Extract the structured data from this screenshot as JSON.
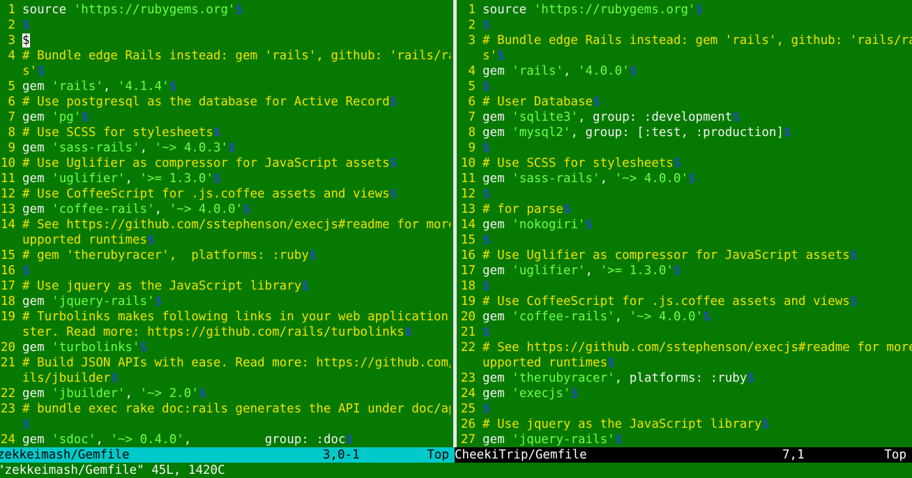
{
  "colors": {
    "background": "#067a00",
    "line_number": "#f2e200",
    "comment": "#f2e200",
    "string": "#6cff4a",
    "eol_marker": "#2a3dff",
    "active_status": "#00c9c9",
    "inactive_status": "#000000"
  },
  "left": {
    "lines": [
      {
        "n": "1",
        "segs": [
          [
            "kw",
            "source "
          ],
          [
            "str",
            "'https://rubygems.org'"
          ],
          [
            "eol",
            "$"
          ]
        ]
      },
      {
        "n": "2",
        "segs": [
          [
            "eol",
            "$"
          ]
        ]
      },
      {
        "n": "3",
        "segs": [
          [
            "cursor",
            "$"
          ]
        ]
      },
      {
        "n": "4",
        "segs": [
          [
            "cmt",
            "# Bundle edge Rails instead: gem 'rails', github: 'rails/rail"
          ]
        ]
      },
      {
        "n": "",
        "segs": [
          [
            "cmt",
            "s'"
          ],
          [
            "eol",
            "$"
          ]
        ]
      },
      {
        "n": "5",
        "segs": [
          [
            "kw",
            "gem "
          ],
          [
            "str",
            "'rails'"
          ],
          [
            "kw",
            ", "
          ],
          [
            "str",
            "'4.1.4'"
          ],
          [
            "eol",
            "$"
          ]
        ]
      },
      {
        "n": "6",
        "segs": [
          [
            "cmt",
            "# Use postgresql as the database for Active Record"
          ],
          [
            "eol",
            "$"
          ]
        ]
      },
      {
        "n": "7",
        "segs": [
          [
            "kw",
            "gem "
          ],
          [
            "str",
            "'pg'"
          ],
          [
            "eol",
            "$"
          ]
        ]
      },
      {
        "n": "8",
        "segs": [
          [
            "cmt",
            "# Use SCSS for stylesheets"
          ],
          [
            "eol",
            "$"
          ]
        ]
      },
      {
        "n": "9",
        "segs": [
          [
            "kw",
            "gem "
          ],
          [
            "str",
            "'sass-rails'"
          ],
          [
            "kw",
            ", "
          ],
          [
            "str",
            "'~> 4.0.3'"
          ],
          [
            "eol",
            "$"
          ]
        ]
      },
      {
        "n": "10",
        "segs": [
          [
            "cmt",
            "# Use Uglifier as compressor for JavaScript assets"
          ],
          [
            "eol",
            "$"
          ]
        ]
      },
      {
        "n": "11",
        "segs": [
          [
            "kw",
            "gem "
          ],
          [
            "str",
            "'uglifier'"
          ],
          [
            "kw",
            ", "
          ],
          [
            "str",
            "'>= 1.3.0'"
          ],
          [
            "eol",
            "$"
          ]
        ]
      },
      {
        "n": "12",
        "segs": [
          [
            "cmt",
            "# Use CoffeeScript for .js.coffee assets and views"
          ],
          [
            "eol",
            "$"
          ]
        ]
      },
      {
        "n": "13",
        "segs": [
          [
            "kw",
            "gem "
          ],
          [
            "str",
            "'coffee-rails'"
          ],
          [
            "kw",
            ", "
          ],
          [
            "str",
            "'~> 4.0.0'"
          ],
          [
            "eol",
            "$"
          ]
        ]
      },
      {
        "n": "14",
        "segs": [
          [
            "cmt",
            "# See https://github.com/sstephenson/execjs#readme for more s"
          ]
        ]
      },
      {
        "n": "",
        "segs": [
          [
            "cmt",
            "upported runtimes"
          ],
          [
            "eol",
            "$"
          ]
        ]
      },
      {
        "n": "15",
        "segs": [
          [
            "cmt",
            "# gem 'therubyracer',  platforms: :ruby"
          ],
          [
            "eol",
            "$"
          ]
        ]
      },
      {
        "n": "16",
        "segs": [
          [
            "eol",
            "$"
          ]
        ]
      },
      {
        "n": "17",
        "segs": [
          [
            "cmt",
            "# Use jquery as the JavaScript library"
          ],
          [
            "eol",
            "$"
          ]
        ]
      },
      {
        "n": "18",
        "segs": [
          [
            "kw",
            "gem "
          ],
          [
            "str",
            "'jquery-rails'"
          ],
          [
            "eol",
            "$"
          ]
        ]
      },
      {
        "n": "19",
        "segs": [
          [
            "cmt",
            "# Turbolinks makes following links in your web application fa"
          ]
        ]
      },
      {
        "n": "",
        "segs": [
          [
            "cmt",
            "ster. Read more: https://github.com/rails/turbolinks"
          ],
          [
            "eol",
            "$"
          ]
        ]
      },
      {
        "n": "20",
        "segs": [
          [
            "kw",
            "gem "
          ],
          [
            "str",
            "'turbolinks'"
          ],
          [
            "eol",
            "$"
          ]
        ]
      },
      {
        "n": "21",
        "segs": [
          [
            "cmt",
            "# Build JSON APIs with ease. Read more: https://github.com/ra"
          ]
        ]
      },
      {
        "n": "",
        "segs": [
          [
            "cmt",
            "ils/jbuilder"
          ],
          [
            "eol",
            "$"
          ]
        ]
      },
      {
        "n": "22",
        "segs": [
          [
            "kw",
            "gem "
          ],
          [
            "str",
            "'jbuilder'"
          ],
          [
            "kw",
            ", "
          ],
          [
            "str",
            "'~> 2.0'"
          ],
          [
            "eol",
            "$"
          ]
        ]
      },
      {
        "n": "23",
        "segs": [
          [
            "cmt",
            "# bundle exec rake doc:rails generates the API under doc/api."
          ]
        ]
      },
      {
        "n": "",
        "segs": [
          [
            "eol",
            "$"
          ]
        ]
      },
      {
        "n": "24",
        "segs": [
          [
            "kw",
            "gem "
          ],
          [
            "str",
            "'sdoc'"
          ],
          [
            "kw",
            ", "
          ],
          [
            "str",
            "'~> 0.4.0'"
          ],
          [
            "kw",
            ",          group: :doc"
          ],
          [
            "eol",
            "$"
          ]
        ]
      }
    ],
    "status": {
      "file": "zekkeimash/Gemfile",
      "position": "3,0-1",
      "percent": "Top"
    }
  },
  "right": {
    "lines": [
      {
        "n": "1",
        "segs": [
          [
            "kw",
            "source "
          ],
          [
            "str",
            "'https://rubygems.org'"
          ],
          [
            "eol",
            "$"
          ]
        ]
      },
      {
        "n": "2",
        "segs": [
          [
            "eol",
            "$"
          ]
        ]
      },
      {
        "n": "3",
        "segs": [
          [
            "cmt",
            "# Bundle edge Rails instead: gem 'rails', github: 'rails/rail"
          ]
        ]
      },
      {
        "n": "",
        "segs": [
          [
            "cmt",
            "s'"
          ],
          [
            "eol",
            "$"
          ]
        ]
      },
      {
        "n": "4",
        "segs": [
          [
            "kw",
            "gem "
          ],
          [
            "str",
            "'rails'"
          ],
          [
            "kw",
            ", "
          ],
          [
            "str",
            "'4.0.0'"
          ],
          [
            "eol",
            "$"
          ]
        ]
      },
      {
        "n": "5",
        "segs": [
          [
            "eol",
            "$"
          ]
        ]
      },
      {
        "n": "6",
        "segs": [
          [
            "cmt",
            "# User Database"
          ],
          [
            "eol",
            "$"
          ]
        ]
      },
      {
        "n": "7",
        "segs": [
          [
            "kw",
            "gem "
          ],
          [
            "str",
            "'sqlite3'"
          ],
          [
            "kw",
            ", group: :development"
          ],
          [
            "eol",
            "$"
          ]
        ]
      },
      {
        "n": "8",
        "segs": [
          [
            "kw",
            "gem "
          ],
          [
            "str",
            "'mysql2'"
          ],
          [
            "kw",
            ", group: [:test, :production]"
          ],
          [
            "eol",
            "$"
          ]
        ]
      },
      {
        "n": "9",
        "segs": [
          [
            "eol",
            "$"
          ]
        ]
      },
      {
        "n": "10",
        "segs": [
          [
            "cmt",
            "# Use SCSS for stylesheets"
          ],
          [
            "eol",
            "$"
          ]
        ]
      },
      {
        "n": "11",
        "segs": [
          [
            "kw",
            "gem "
          ],
          [
            "str",
            "'sass-rails'"
          ],
          [
            "kw",
            ", "
          ],
          [
            "str",
            "'~> 4.0.0'"
          ],
          [
            "eol",
            "$"
          ]
        ]
      },
      {
        "n": "12",
        "segs": [
          [
            "eol",
            "$"
          ]
        ]
      },
      {
        "n": "13",
        "segs": [
          [
            "cmt",
            "# for parse"
          ],
          [
            "eol",
            "$"
          ]
        ]
      },
      {
        "n": "14",
        "segs": [
          [
            "kw",
            "gem "
          ],
          [
            "str",
            "'nokogiri'"
          ],
          [
            "eol",
            "$"
          ]
        ]
      },
      {
        "n": "15",
        "segs": [
          [
            "eol",
            "$"
          ]
        ]
      },
      {
        "n": "16",
        "segs": [
          [
            "cmt",
            "# Use Uglifier as compressor for JavaScript assets"
          ],
          [
            "eol",
            "$"
          ]
        ]
      },
      {
        "n": "17",
        "segs": [
          [
            "kw",
            "gem "
          ],
          [
            "str",
            "'uglifier'"
          ],
          [
            "kw",
            ", "
          ],
          [
            "str",
            "'>= 1.3.0'"
          ],
          [
            "eol",
            "$"
          ]
        ]
      },
      {
        "n": "18",
        "segs": [
          [
            "eol",
            "$"
          ]
        ]
      },
      {
        "n": "19",
        "segs": [
          [
            "cmt",
            "# Use CoffeeScript for .js.coffee assets and views"
          ],
          [
            "eol",
            "$"
          ]
        ]
      },
      {
        "n": "20",
        "segs": [
          [
            "kw",
            "gem "
          ],
          [
            "str",
            "'coffee-rails'"
          ],
          [
            "kw",
            ", "
          ],
          [
            "str",
            "'~> 4.0.0'"
          ],
          [
            "eol",
            "$"
          ]
        ]
      },
      {
        "n": "21",
        "segs": [
          [
            "eol",
            "$"
          ]
        ]
      },
      {
        "n": "22",
        "segs": [
          [
            "cmt",
            "# See https://github.com/sstephenson/execjs#readme for more s"
          ]
        ]
      },
      {
        "n": "",
        "segs": [
          [
            "cmt",
            "upported runtimes"
          ],
          [
            "eol",
            "$"
          ]
        ]
      },
      {
        "n": "23",
        "segs": [
          [
            "kw",
            "gem "
          ],
          [
            "str",
            "'therubyracer'"
          ],
          [
            "kw",
            ", platforms: :ruby"
          ],
          [
            "eol",
            "$"
          ]
        ]
      },
      {
        "n": "24",
        "segs": [
          [
            "kw",
            "gem "
          ],
          [
            "str",
            "'execjs'"
          ],
          [
            "eol",
            "$"
          ]
        ]
      },
      {
        "n": "25",
        "segs": [
          [
            "eol",
            "$"
          ]
        ]
      },
      {
        "n": "26",
        "segs": [
          [
            "cmt",
            "# Use jquery as the JavaScript library"
          ],
          [
            "eol",
            "$"
          ]
        ]
      },
      {
        "n": "27",
        "segs": [
          [
            "kw",
            "gem "
          ],
          [
            "str",
            "'jquery-rails'"
          ],
          [
            "eol",
            "$"
          ]
        ]
      }
    ],
    "status": {
      "file": "CheekiTrip/Gemfile",
      "position": "7,1",
      "percent": "Top"
    }
  },
  "cmdline": "\"zekkeimash/Gemfile\" 45L, 1420C"
}
